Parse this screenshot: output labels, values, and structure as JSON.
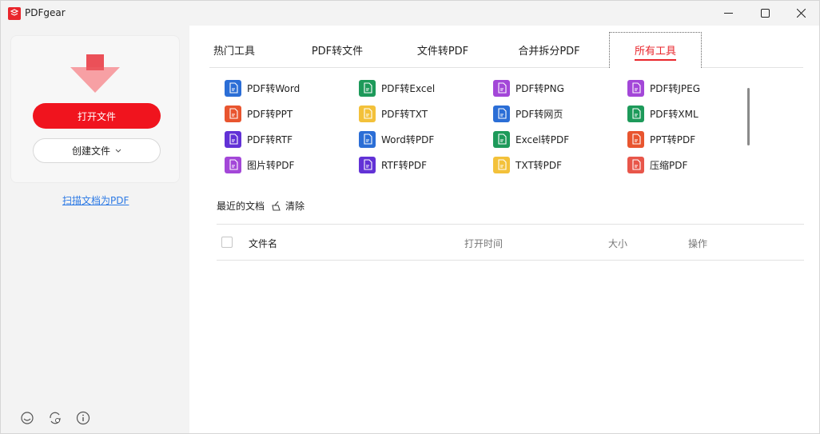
{
  "app": {
    "title": "PDFgear"
  },
  "window_controls": {
    "minimize": "—",
    "maximize": "☐",
    "close": "✕"
  },
  "sidebar": {
    "open_label": "打开文件",
    "create_label": "创建文件",
    "scan_label": "扫描文档为PDF"
  },
  "tabs": [
    {
      "label": "热门工具"
    },
    {
      "label": "PDF转文件"
    },
    {
      "label": "文件转PDF"
    },
    {
      "label": "合并拆分PDF"
    },
    {
      "label": "所有工具"
    }
  ],
  "active_tab": "所有工具",
  "tools": [
    {
      "label": "PDF转Word",
      "color": "#2b6ed6",
      "icon": "word-icon"
    },
    {
      "label": "PDF转Excel",
      "color": "#1d9a5a",
      "icon": "excel-icon"
    },
    {
      "label": "PDF转PNG",
      "color": "#a347d8",
      "icon": "png-icon"
    },
    {
      "label": "PDF转JPEG",
      "color": "#a347d8",
      "icon": "jpeg-icon"
    },
    {
      "label": "PDF转PPT",
      "color": "#e8552f",
      "icon": "ppt-icon"
    },
    {
      "label": "PDF转TXT",
      "color": "#f3c13a",
      "icon": "txt-icon"
    },
    {
      "label": "PDF转网页",
      "color": "#2b6ed6",
      "icon": "web-icon"
    },
    {
      "label": "PDF转XML",
      "color": "#1d9a5a",
      "icon": "xml-icon"
    },
    {
      "label": "PDF转RTF",
      "color": "#6232d6",
      "icon": "rtf-icon"
    },
    {
      "label": "Word转PDF",
      "color": "#2b6ed6",
      "icon": "word-icon"
    },
    {
      "label": "Excel转PDF",
      "color": "#1d9a5a",
      "icon": "excel-icon"
    },
    {
      "label": "PPT转PDF",
      "color": "#e8552f",
      "icon": "ppt-icon"
    },
    {
      "label": "图片转PDF",
      "color": "#a347d8",
      "icon": "image-icon"
    },
    {
      "label": "RTF转PDF",
      "color": "#6232d6",
      "icon": "rtf-icon"
    },
    {
      "label": "TXT转PDF",
      "color": "#f3c13a",
      "icon": "txt-icon"
    },
    {
      "label": "压缩PDF",
      "color": "#e8564a",
      "icon": "compress-icon"
    }
  ],
  "recent": {
    "title": "最近的文档",
    "clear_label": "清除"
  },
  "table": {
    "headers": [
      "文件名",
      "打开时间",
      "大小",
      "操作"
    ]
  },
  "colors": {
    "accent": "#e9262c",
    "link": "#2d7ae5"
  }
}
